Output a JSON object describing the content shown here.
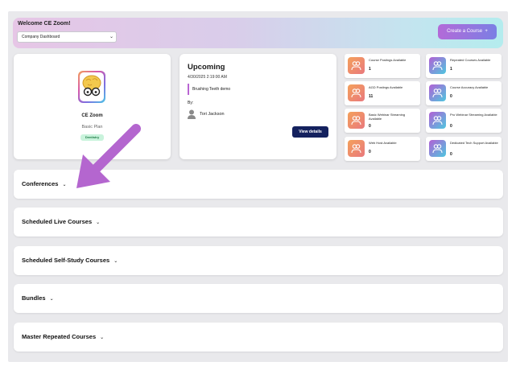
{
  "header": {
    "welcome": "Welcome CE Zoom!",
    "dashboard_select": "Company Dashboard",
    "create_course_label": "Create a Course",
    "create_course_icon": "plus-icon"
  },
  "profile": {
    "name": "CE Zoom",
    "plan": "Basic Plan",
    "badge": "Dentistry"
  },
  "upcoming": {
    "title": "Upcoming",
    "date": "4/30/2025 2:19:00 AM",
    "event": "Brushing Teeth demo",
    "by_label": "By:",
    "person": "Tori Jackson",
    "view_details": "View details"
  },
  "stats": [
    {
      "label": "Course Postings Available",
      "value": "1",
      "color": "orange"
    },
    {
      "label": "Repeated Courses Available",
      "value": "1",
      "color": "purple"
    },
    {
      "label": "AGD Postings Available",
      "value": "11",
      "color": "orange"
    },
    {
      "label": "Course Accuracy Available",
      "value": "0",
      "color": "purple"
    },
    {
      "label": "Basic Webinar Streaming Available",
      "value": "0",
      "color": "orange"
    },
    {
      "label": "Pro Webinar Streaming Available",
      "value": "0",
      "color": "purple"
    },
    {
      "label": "Web Host Available",
      "value": "0",
      "color": "orange"
    },
    {
      "label": "Dedicated Tech Support Available",
      "value": "0",
      "color": "purple"
    }
  ],
  "sections": [
    {
      "title": "Conferences"
    },
    {
      "title": "Scheduled Live Courses"
    },
    {
      "title": "Scheduled Self-Study Courses"
    },
    {
      "title": "Bundles"
    },
    {
      "title": "Master Repeated Courses"
    }
  ],
  "colors": {
    "accent_purple": "#b965d3",
    "button_navy": "#14215e",
    "badge_green": "#c9f3dc",
    "annotation_arrow": "#b466cf"
  }
}
